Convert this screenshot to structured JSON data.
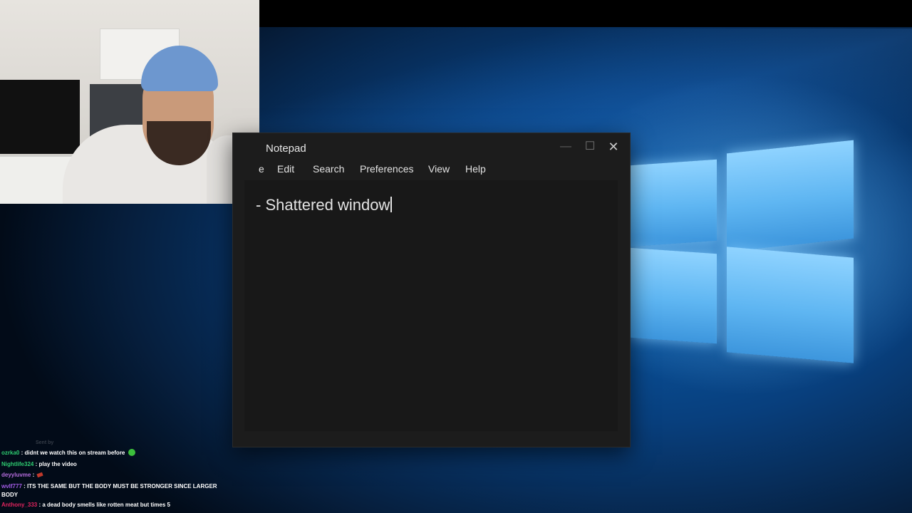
{
  "notepad": {
    "title": "Notepad",
    "window_controls": {
      "minimize": "—",
      "maximize": "☐",
      "close": "✕"
    },
    "menu": {
      "file_fragment": "e",
      "edit": "Edit",
      "search": "Search",
      "preferences": "Preferences",
      "view": "View",
      "help": "Help"
    },
    "content": "- Shattered window"
  },
  "chat": {
    "faint_line": "Sent by",
    "messages": [
      {
        "user": "ozrka0",
        "user_color": "#2ecc71",
        "text": " : didnt we watch this on stream before ",
        "emote": "green-face-emote"
      },
      {
        "user": "Nightlife324",
        "user_color": "#2ecc71",
        "text": " : play the video",
        "emote": ""
      },
      {
        "user": "deyyluvme",
        "user_color": "#b36bdb",
        "text": " : ",
        "emote": "red-emote"
      },
      {
        "user": "wvlf777",
        "user_color": "#a35ce6",
        "text": " : ITS THE SAME BUT THE BODY MUST BE STRONGER SINCE LARGER BODY",
        "emote": ""
      },
      {
        "user": "Anthony_333",
        "user_color": "#e0245e",
        "text": " : a dead body smells like rotten meat but times 5",
        "emote": ""
      }
    ]
  },
  "colors": {
    "wallpaper_blue": "#0b5fb0",
    "notepad_bg": "#1c1c1c",
    "editor_bg": "#181818"
  }
}
